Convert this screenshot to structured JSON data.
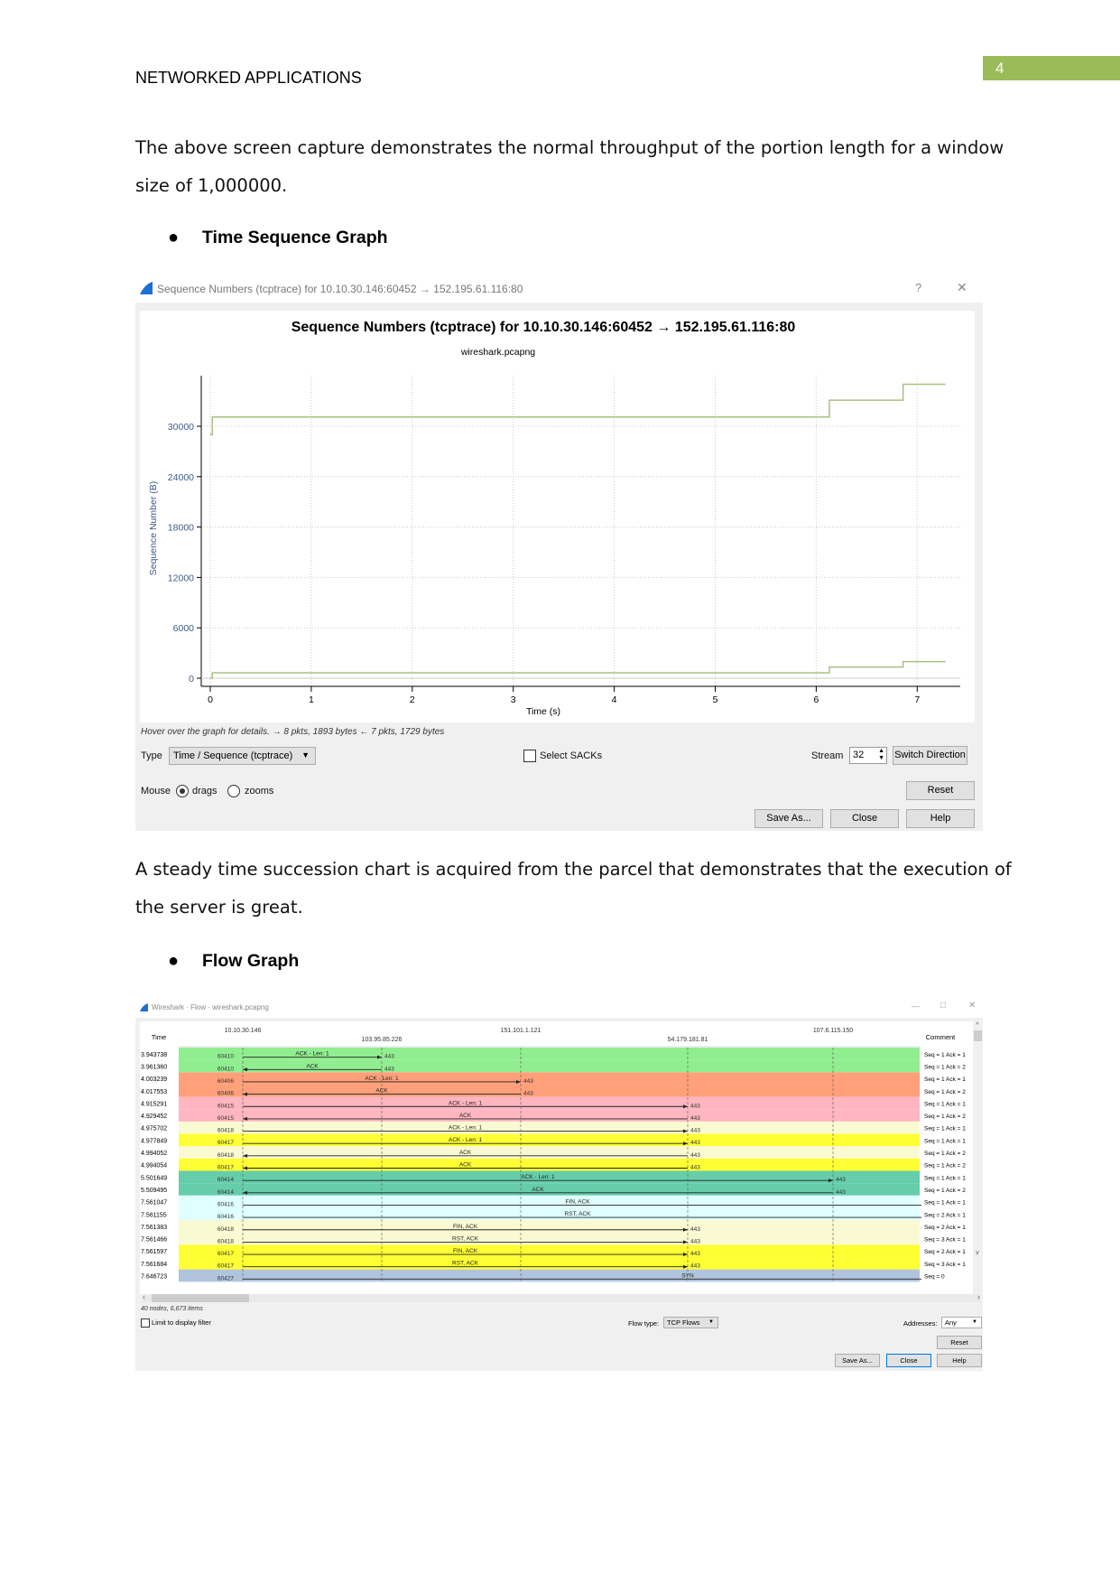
{
  "header": {
    "title": "NETWORKED APPLICATIONS",
    "page_number": "4",
    "accent": "#9bbb59"
  },
  "paragraph1": {
    "line1": "The above screen capture demonstrates the normal throughput of the portion length for a window",
    "line2": "size of 1,000000."
  },
  "bullet1": "Time Sequence Graph",
  "seq_window": {
    "title": "Sequence Numbers (tcptrace) for 10.10.30.146:60452 → 152.195.61.116:80",
    "help_icon": "?",
    "close_icon": "✕",
    "hover_text": "Hover over the graph for details. → 8 pkts, 1893 bytes ← 7 pkts, 1729 bytes",
    "type_label": "Type",
    "type_value": "Time / Sequence (tcptrace)",
    "select_sacks": "Select SACKs",
    "stream_label": "Stream",
    "stream_value": "32",
    "switch_direction": "Switch Direction",
    "mouse_label": "Mouse",
    "drags": "drags",
    "zooms": "zooms",
    "mouse_mode": "drags",
    "reset": "Reset",
    "save_as": "Save As...",
    "close": "Close",
    "help": "Help"
  },
  "chart_data": {
    "type": "line",
    "title": "Sequence Numbers (tcptrace) for 10.10.30.146:60452 → 152.195.61.116:80",
    "subtitle": "wireshark.pcapng",
    "xlabel": "Time (s)",
    "ylabel": "Sequence Number (B)",
    "xlim": [
      0,
      7.4
    ],
    "ylim": [
      -800,
      36000
    ],
    "xticks": [
      "0",
      "1",
      "2",
      "3",
      "4",
      "5",
      "6",
      "7"
    ],
    "yticks": [
      "0",
      "6000",
      "12000",
      "18000",
      "24000",
      "30000"
    ],
    "grid": true,
    "line_color": "#a8c080",
    "series": [
      {
        "x": [
          0.0,
          0.02,
          0.02,
          6.13,
          6.13,
          6.86,
          6.86,
          7.28
        ],
        "y": [
          29000,
          29000,
          31100,
          31100,
          33100,
          33100,
          35000,
          35000
        ]
      },
      {
        "x": [
          0.0,
          0.02,
          0.02,
          6.13,
          6.13,
          6.86,
          6.86,
          7.28
        ],
        "y": [
          0,
          0,
          650,
          650,
          1330,
          1330,
          1970,
          1970
        ]
      }
    ]
  },
  "paragraph2": {
    "line1": "A steady time succession chart is acquired from the parcel that demonstrates that the execution of",
    "line2": "the server is great."
  },
  "bullet2": "Flow Graph",
  "flow_window": {
    "title": "Wireshark · Flow · wireshark.pcapng",
    "minimize_icon": "—",
    "maximize_icon": "□",
    "close_icon": "✕",
    "time_header": "Time",
    "comment_header": "Comment",
    "nodes": [
      "10.10.30.146",
      "103.95.85.226",
      "151.101.1.121",
      "54.179.181.81",
      "107.6.115.150"
    ],
    "rows": [
      {
        "time": "3.943738",
        "port": "60410",
        "color": "#90ee90",
        "dir": "right",
        "to": 1,
        "label": "ACK - Len: 1",
        "end_port": "443",
        "comment": "Seq = 1 Ack = 1"
      },
      {
        "time": "3.961360",
        "port": "60410",
        "color": "#90ee90",
        "dir": "left",
        "to": 1,
        "label": "ACK",
        "end_port": "443",
        "comment": "Seq = 1 Ack = 2"
      },
      {
        "time": "4.003239",
        "port": "60406",
        "color": "#ffa07a",
        "dir": "right",
        "to": 2,
        "label": "ACK - Len: 1",
        "end_port": "443",
        "comment": "Seq = 1 Ack = 1"
      },
      {
        "time": "4.017553",
        "port": "60406",
        "color": "#ffa07a",
        "dir": "left",
        "to": 2,
        "label": "ACK",
        "end_port": "443",
        "comment": "Seq = 1 Ack = 2"
      },
      {
        "time": "4.915291",
        "port": "60415",
        "color": "#ffb6c1",
        "dir": "right",
        "to": 3,
        "label": "ACK - Len: 1",
        "end_port": "443",
        "comment": "Seq = 1 Ack = 1"
      },
      {
        "time": "4.929452",
        "port": "60415",
        "color": "#ffb6c1",
        "dir": "left",
        "to": 3,
        "label": "ACK",
        "end_port": "443",
        "comment": "Seq = 1 Ack = 2"
      },
      {
        "time": "4.975702",
        "port": "60418",
        "color": "#fafad2",
        "dir": "right",
        "to": 3,
        "label": "ACK - Len: 1",
        "end_port": "443",
        "comment": "Seq = 1 Ack = 1"
      },
      {
        "time": "4.977849",
        "port": "60417",
        "color": "#ffff33",
        "dir": "right",
        "to": 3,
        "label": "ACK - Len: 1",
        "end_port": "443",
        "comment": "Seq = 1 Ack = 1"
      },
      {
        "time": "4.994052",
        "port": "60418",
        "color": "#fafad2",
        "dir": "left",
        "to": 3,
        "label": "ACK",
        "end_port": "443",
        "comment": "Seq = 1 Ack = 2"
      },
      {
        "time": "4.994054",
        "port": "60417",
        "color": "#ffff33",
        "dir": "left",
        "to": 3,
        "label": "ACK",
        "end_port": "443",
        "comment": "Seq = 1 Ack = 2"
      },
      {
        "time": "5.501649",
        "port": "60414",
        "color": "#66cdaa",
        "dir": "right",
        "to": 4,
        "label": "ACK - Len: 1",
        "end_port": "443",
        "comment": "Seq = 1 Ack = 1"
      },
      {
        "time": "5.509495",
        "port": "60414",
        "color": "#66cdaa",
        "dir": "left",
        "to": 4,
        "label": "ACK",
        "end_port": "443",
        "comment": "Seq = 1 Ack = 2"
      },
      {
        "time": "7.561047",
        "port": "60416",
        "color": "#e0ffff",
        "dir": "right",
        "to": 5,
        "label": "FIN, ACK",
        "end_port": "",
        "comment": "Seq = 1 Ack = 1"
      },
      {
        "time": "7.561155",
        "port": "60416",
        "color": "#e0ffff",
        "dir": "right",
        "to": 5,
        "label": "RST, ACK",
        "end_port": "",
        "comment": "Seq = 2 Ack = 1"
      },
      {
        "time": "7.561383",
        "port": "60418",
        "color": "#fafad2",
        "dir": "right",
        "to": 3,
        "label": "FIN, ACK",
        "end_port": "443",
        "comment": "Seq = 2 Ack = 1"
      },
      {
        "time": "7.561466",
        "port": "60418",
        "color": "#fafad2",
        "dir": "right",
        "to": 3,
        "label": "RST, ACK",
        "end_port": "443",
        "comment": "Seq = 3 Ack = 1"
      },
      {
        "time": "7.561597",
        "port": "60417",
        "color": "#ffff33",
        "dir": "right",
        "to": 3,
        "label": "FIN, ACK",
        "end_port": "443",
        "comment": "Seq = 2 Ack = 1"
      },
      {
        "time": "7.561684",
        "port": "60417",
        "color": "#ffff33",
        "dir": "right",
        "to": 3,
        "label": "RST, ACK",
        "end_port": "443",
        "comment": "Seq = 3 Ack = 1"
      },
      {
        "time": "7.646723",
        "port": "60427",
        "color": "#b0c4de",
        "dir": "right",
        "to": 5,
        "label": "SYN",
        "end_port": "",
        "comment": "Seq = 0"
      }
    ],
    "status": "40 nodes, 6,673 items",
    "limit_filter": "Limit to display filter",
    "flow_type_label": "Flow type:",
    "flow_type_value": "TCP Flows",
    "addresses_label": "Addresses:",
    "addresses_value": "Any",
    "reset": "Reset",
    "save_as": "Save As...",
    "close": "Close",
    "help": "Help"
  }
}
